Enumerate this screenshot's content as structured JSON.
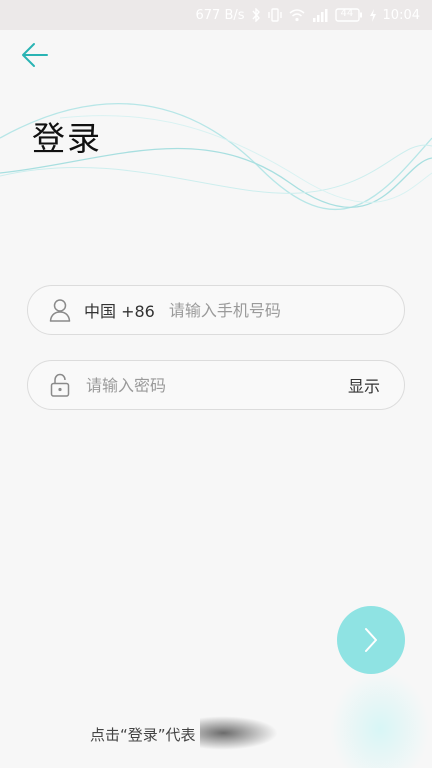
{
  "status_bar": {
    "speed": "677 B/s",
    "battery": "44",
    "time": "10:04",
    "icons": [
      "bluetooth-icon",
      "vibrate-icon",
      "wifi-icon",
      "signal-icon",
      "battery-icon",
      "charging-icon"
    ]
  },
  "header": {
    "back_icon": "arrow-left-icon",
    "title": "登录"
  },
  "form": {
    "phone": {
      "icon": "user-icon",
      "country_code": "中国 +86",
      "placeholder": "请输入手机号码",
      "value": ""
    },
    "password": {
      "icon": "lock-icon",
      "placeholder": "请输入密码",
      "value": "",
      "toggle_label": "显示"
    }
  },
  "next_button": {
    "icon": "chevron-right-icon"
  },
  "footer": {
    "agreement_text": "点击“登录”代表"
  },
  "colors": {
    "accent": "#2ab4b4",
    "next_button": "#8fe3e3",
    "background": "#f7f7f7",
    "status_bar": "#ece9e9",
    "wave": "#a8dfe0"
  }
}
